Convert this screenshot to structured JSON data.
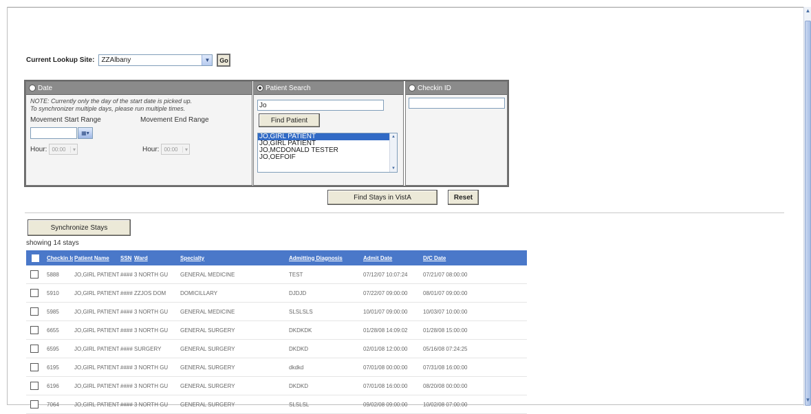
{
  "lookup": {
    "label": "Current Lookup Site:",
    "site": "ZZAlbany",
    "go_label": "Go"
  },
  "date_panel": {
    "title": "Date",
    "note_line1": "NOTE: Currently only the day of the start date is picked up.",
    "note_line2": "To synchronizer multiple days, please run multiple times.",
    "start_label": "Movement Start Range",
    "end_label": "Movement End Range",
    "hour_label": "Hour:",
    "hour_start": "00:00",
    "hour_end": "00:00"
  },
  "patient_panel": {
    "title": "Patient Search",
    "search_value": "Jo",
    "find_label": "Find Patient",
    "results": [
      "JO,GIRL PATIENT",
      "JO,GIRL PATIENT",
      "JO,MCDONALD TESTER",
      "JO,OEFOIF"
    ]
  },
  "checkin_panel": {
    "title": "Checkin ID",
    "value": ""
  },
  "actions": {
    "find_stays": "Find Stays in VistA",
    "reset": "Reset",
    "synchronize": "Synchronize Stays"
  },
  "showing": "showing 14 stays",
  "table": {
    "headers": [
      "Checkin Id",
      "Patient Name",
      "SSN",
      "Ward",
      "Specialty",
      "Admitting Diagnosis",
      "Admit Date",
      "D/C Date"
    ],
    "rows": [
      [
        "5888",
        "JO,GIRL PATIENT",
        "####",
        "3 NORTH GU",
        "GENERAL MEDICINE",
        "TEST",
        "07/12/07 10:07:24",
        "07/21/07 08:00:00"
      ],
      [
        "5910",
        "JO,GIRL PATIENT",
        "####",
        "ZZJOS DOM",
        "DOMICILLARY",
        "DJDJD",
        "07/22/07 09:00:00",
        "08/01/07 09:00:00"
      ],
      [
        "5985",
        "JO,GIRL PATIENT",
        "####",
        "3 NORTH GU",
        "GENERAL MEDICINE",
        "SLSLSLS",
        "10/01/07 09:00:00",
        "10/03/07 10:00:00"
      ],
      [
        "6655",
        "JO,GIRL PATIENT",
        "####",
        "3 NORTH GU",
        "GENERAL SURGERY",
        "DKDKDK",
        "01/28/08 14:09:02",
        "01/28/08 15:00:00"
      ],
      [
        "6595",
        "JO,GIRL PATIENT",
        "####",
        "SURGERY",
        "GENERAL SURGERY",
        "DKDKD",
        "02/01/08 12:00:00",
        "05/16/08 07:24:25"
      ],
      [
        "6195",
        "JO,GIRL PATIENT",
        "####",
        "3 NORTH GU",
        "GENERAL SURGERY",
        "dkdkd",
        "07/01/08 00:00:00",
        "07/31/08 16:00:00"
      ],
      [
        "6196",
        "JO,GIRL PATIENT",
        "####",
        "3 NORTH GU",
        "GENERAL SURGERY",
        "DKDKD",
        "07/01/08 16:00:00",
        "08/20/08 00:00:00"
      ],
      [
        "7064",
        "JO,GIRL PATIENT",
        "####",
        "3 NORTH GU",
        "GENERAL SURGERY",
        "SLSLSL",
        "09/02/08 09:00:00",
        "10/02/08 07:00:00"
      ]
    ]
  },
  "colors": {
    "grid_header": "#4a78c9",
    "panel_header": "#8b8b8b",
    "selected_item": "#316ac5"
  }
}
